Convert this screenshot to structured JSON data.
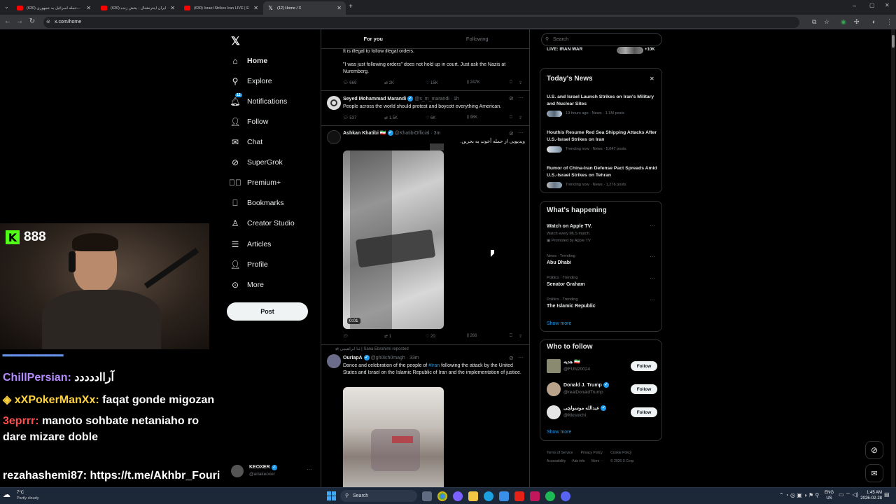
{
  "browser": {
    "tabs": [
      {
        "title": "(630) حمله اسرائیل به جمهوری..."
      },
      {
        "title": "(630) ایران اینترنشنال - پخش زنده"
      },
      {
        "title": "(630) Israel Strikes Iran LIVE | Ex..."
      },
      {
        "title": "(12) Home / X"
      }
    ],
    "url": "x.com/home"
  },
  "nav": {
    "items": [
      {
        "label": "Home",
        "icon": "home-icon"
      },
      {
        "label": "Explore",
        "icon": "search-icon"
      },
      {
        "label": "Notifications",
        "icon": "bell-icon",
        "badge": "12"
      },
      {
        "label": "Follow",
        "icon": "follow-icon"
      },
      {
        "label": "Chat",
        "icon": "mail-icon"
      },
      {
        "label": "SuperGrok",
        "icon": "grok-icon"
      },
      {
        "label": "Premium+",
        "icon": "premium-icon"
      },
      {
        "label": "Bookmarks",
        "icon": "bookmark-icon"
      },
      {
        "label": "Creator Studio",
        "icon": "creator-icon"
      },
      {
        "label": "Articles",
        "icon": "article-icon"
      },
      {
        "label": "Profile",
        "icon": "profile-icon"
      },
      {
        "label": "More",
        "icon": "more-icon"
      }
    ],
    "post_label": "Post",
    "account": {
      "name": "KEOXER",
      "handle": "@ariakeoxer"
    }
  },
  "feed": {
    "tabs": [
      "For you",
      "Following"
    ],
    "tweet0": {
      "line1": "It is illegal to follow illegal orders.",
      "line2": "\"I was just following orders\" does not hold up in court. Just ask the Nazis at Nuremberg.",
      "replies": "669",
      "reposts": "2K",
      "likes": "15K",
      "views": "247K"
    },
    "tweet1": {
      "name": "Seyed Mohammad Marandi",
      "handle": "@s_m_marandi · 1h",
      "text": "People across the world should protest and boycott everything American.",
      "replies": "537",
      "reposts": "1.5K",
      "likes": "6K",
      "views": "98K"
    },
    "tweet2": {
      "name": "Ashkan Khatibi 🇮🇷",
      "handle": "@KhatibiOfficial · 3m",
      "text": "ویدیویی از حمله آخوند به بحرین.",
      "duration": "0:01",
      "reposts": "1",
      "likes": "20",
      "views": "266"
    },
    "tweet3": {
      "repost_by": "ثنا ابراهیمی | Sana Ebrahimi reposted",
      "name": "OuriapA",
      "handle": "@gh0ich0magh · 33m",
      "text_a": "Dance and celebration of the people of",
      "hashtag": "#Iran",
      "text_b": "following the attack by the United States and Israel on the Islamic Republic of Iran and the implementation of justice."
    }
  },
  "right": {
    "search_placeholder": "Search",
    "live": {
      "label": "LIVE: IRAN WAR",
      "count": "+10K"
    },
    "todays_news": {
      "title": "Today's News",
      "items": [
        {
          "title": "U.S. and Israel Launch Strikes on Iran's Military and Nuclear Sites",
          "meta": "19 hours ago · News · 1.1M posts"
        },
        {
          "title": "Houthis Resume Red Sea Shipping Attacks After U.S.-Israel Strikes on Iran",
          "meta": "Trending now · News · 5,047 posts"
        },
        {
          "title": "Rumor of China-Iran Defense Pact Spreads Amid U.S.-Israel Strikes on Tehran",
          "meta": "Trending now · News · 1,276 posts"
        }
      ]
    },
    "happening": {
      "title": "What's happening",
      "items": [
        {
          "meta": "",
          "title": "Watch on Apple TV.",
          "sub": "Watch every MLS match.",
          "promo": "Promoted by Apple TV"
        },
        {
          "meta": "News · Trending",
          "title": "Abu Dhabi"
        },
        {
          "meta": "Politics · Trending",
          "title": "Senator Graham"
        },
        {
          "meta": "Politics · Trending",
          "title": "The Islamic Republic"
        }
      ],
      "show_more": "Show more"
    },
    "who_to_follow": {
      "title": "Who to follow",
      "items": [
        {
          "name": "هدیه 🇮🇷",
          "handle": "@FUN20024"
        },
        {
          "name": "Donald J. Trump",
          "handle": "@realDonaldTrump"
        },
        {
          "name": "عبدالله موسولچی",
          "handle": "@Mosolchi"
        }
      ],
      "follow_label": "Follow",
      "show_more": "Show more"
    },
    "footer": [
      "Terms of Service",
      "Privacy Policy",
      "Cookie Policy",
      "Accessibility",
      "Ads info",
      "More ···",
      "© 2026 X Corp."
    ]
  },
  "stream": {
    "sponsor_count": "888",
    "chat": [
      {
        "user": "ChillPersian:",
        "color": "#b58cff",
        "msg": "آرااددددد"
      },
      {
        "user": "xXPokerManXx:",
        "color": "#ffd23f",
        "msg": "faqat gonde migozan"
      },
      {
        "user": "3eprrr:",
        "color": "#ff4d4d",
        "msg": "manoto sohbate netaniaho ro"
      },
      {
        "user": "",
        "color": "#fff",
        "msg": "dare mizare doble"
      },
      {
        "user": "rezahashemi87:",
        "color": "#ffffff",
        "msg": "https://t.me/Akhbr_Fouri"
      }
    ]
  },
  "taskbar": {
    "weather_temp": "7°C",
    "weather_text": "Partly cloudy",
    "search_label": "Search",
    "lang": "ENG",
    "region": "US",
    "time": "1:45 AM",
    "date": "2026-02-28"
  }
}
